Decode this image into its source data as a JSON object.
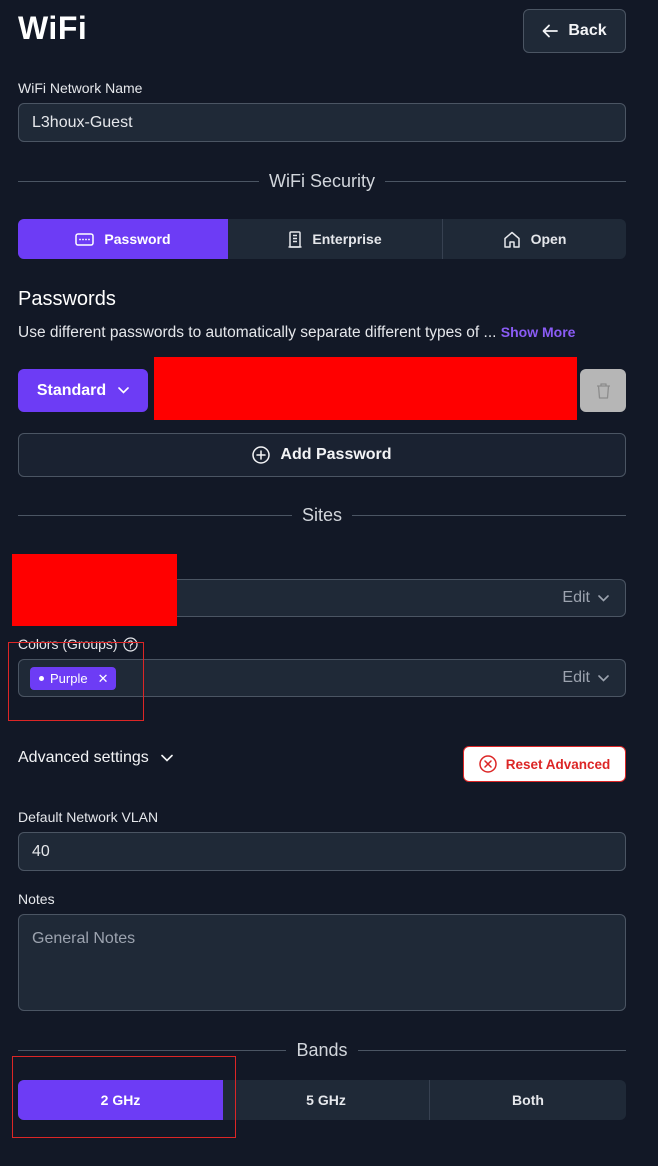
{
  "header": {
    "title": "WiFi",
    "back_label": "Back"
  },
  "network_name": {
    "label": "WiFi Network Name",
    "value": "L3houx-Guest"
  },
  "security": {
    "divider_label": "WiFi Security",
    "options": [
      "Password",
      "Enterprise",
      "Open"
    ],
    "selected": "Password"
  },
  "passwords": {
    "title": "Passwords",
    "description": "Use different passwords to automatically separate different types of ...",
    "show_more": "Show More",
    "type_label": "Standard",
    "add_label": "Add Password"
  },
  "sites": {
    "divider_label": "Sites",
    "edit_label": "Edit"
  },
  "colors": {
    "label": "Colors (Groups)",
    "chip_label": "Purple",
    "edit_label": "Edit"
  },
  "advanced": {
    "label": "Advanced settings",
    "reset_label": "Reset Advanced",
    "vlan_label": "Default Network VLAN",
    "vlan_value": "40",
    "notes_label": "Notes",
    "notes_placeholder": "General Notes"
  },
  "bands": {
    "divider_label": "Bands",
    "options": [
      "2 GHz",
      "5 GHz",
      "Both"
    ],
    "selected": "2 GHz"
  },
  "theme": {
    "accent": "#6d3cf5",
    "danger": "#dc2626",
    "background": "#121826"
  }
}
